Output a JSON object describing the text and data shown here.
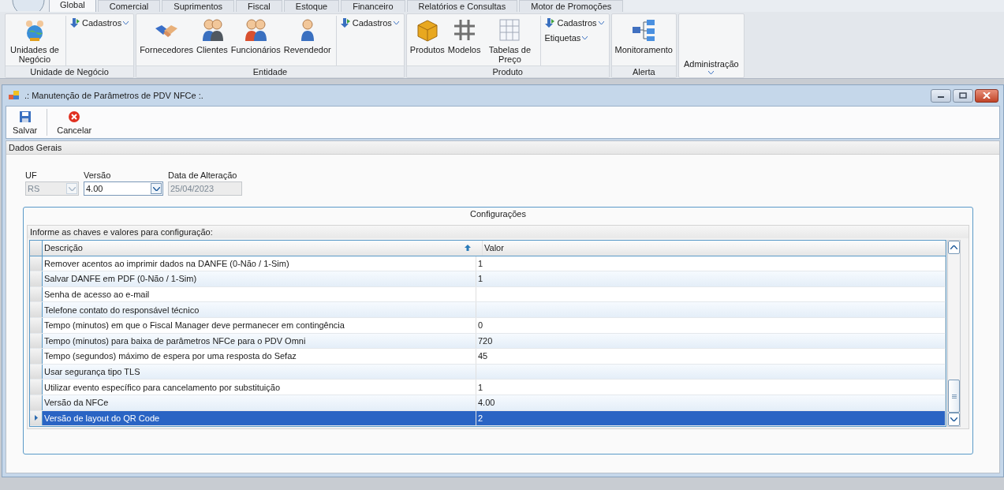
{
  "ribbon": {
    "tabs": [
      {
        "label": "Global",
        "selected": true
      },
      {
        "label": "Comercial",
        "selected": false
      },
      {
        "label": "Suprimentos",
        "selected": false
      },
      {
        "label": "Fiscal",
        "selected": false
      },
      {
        "label": "Estoque",
        "selected": false
      },
      {
        "label": "Financeiro",
        "selected": false
      },
      {
        "label": "Relatórios e Consultas",
        "selected": false
      },
      {
        "label": "Motor de Promoções",
        "selected": false
      }
    ],
    "groups": [
      {
        "label": "Unidade de Negócio",
        "items": [
          {
            "kind": "large",
            "label": "Unidades de Negócio"
          },
          {
            "kind": "menus",
            "menus": [
              "Cadastros"
            ]
          }
        ]
      },
      {
        "label": "Entidade",
        "items": [
          {
            "kind": "large",
            "label": "Fornecedores"
          },
          {
            "kind": "large",
            "label": "Clientes"
          },
          {
            "kind": "large",
            "label": "Funcionários"
          },
          {
            "kind": "large",
            "label": "Revendedor"
          },
          {
            "kind": "menus",
            "menus": [
              "Cadastros"
            ]
          }
        ]
      },
      {
        "label": "Produto",
        "items": [
          {
            "kind": "large",
            "label": "Produtos"
          },
          {
            "kind": "large",
            "label": "Modelos"
          },
          {
            "kind": "large",
            "label": "Tabelas de Preço"
          },
          {
            "kind": "menus",
            "menus": [
              "Cadastros",
              "Etiquetas"
            ]
          }
        ]
      },
      {
        "label": "Alerta",
        "items": [
          {
            "kind": "large",
            "label": "Monitoramento"
          }
        ]
      },
      {
        "items": [
          {
            "kind": "dropdown",
            "label": "Administração"
          }
        ]
      }
    ]
  },
  "window": {
    "title": ".: Manutenção de Parâmetros de PDV NFCe :.",
    "toolbar": [
      {
        "label": "Salvar"
      },
      {
        "label": "Cancelar"
      }
    ],
    "section": "Dados Gerais",
    "fields": [
      {
        "label": "UF",
        "value": "RS",
        "kind": "combo",
        "disabled": true
      },
      {
        "label": "Versão",
        "value": "4.00",
        "kind": "combo",
        "disabled": false
      },
      {
        "label": "Data de Alteração",
        "value": "25/04/2023",
        "kind": "text",
        "disabled": true
      }
    ],
    "group_box": {
      "title": "Configurações",
      "hint": "Informe as chaves e valores para configuração:",
      "table": {
        "columns": [
          {
            "label": "Descrição",
            "sorted": true
          },
          {
            "label": "Valor",
            "sorted": false
          }
        ],
        "rows": [
          {
            "cells": [
              "Remover acentos ao imprimir dados na DANFE (0-Não / 1-Sim)",
              "1"
            ],
            "selected": false
          },
          {
            "cells": [
              "Salvar DANFE em PDF (0-Não / 1-Sim)",
              "1"
            ],
            "selected": false
          },
          {
            "cells": [
              "Senha de acesso ao e-mail",
              ""
            ],
            "selected": false
          },
          {
            "cells": [
              "Telefone contato do responsável técnico",
              ""
            ],
            "selected": false
          },
          {
            "cells": [
              "Tempo (minutos) em que o Fiscal Manager deve permanecer em contingência",
              "0"
            ],
            "selected": false
          },
          {
            "cells": [
              "Tempo (minutos) para baixa de parâmetros NFCe para o PDV Omni",
              "720"
            ],
            "selected": false
          },
          {
            "cells": [
              "Tempo (segundos) máximo de espera por uma resposta do Sefaz",
              "45"
            ],
            "selected": false
          },
          {
            "cells": [
              "Usar segurança tipo TLS",
              ""
            ],
            "selected": false
          },
          {
            "cells": [
              "Utilizar evento específico para cancelamento por substituição",
              "1"
            ],
            "selected": false
          },
          {
            "cells": [
              "Versão da NFCe",
              "4.00"
            ],
            "selected": false
          },
          {
            "cells": [
              "Versão de layout do QR Code",
              "2"
            ],
            "selected": true
          }
        ]
      }
    }
  }
}
